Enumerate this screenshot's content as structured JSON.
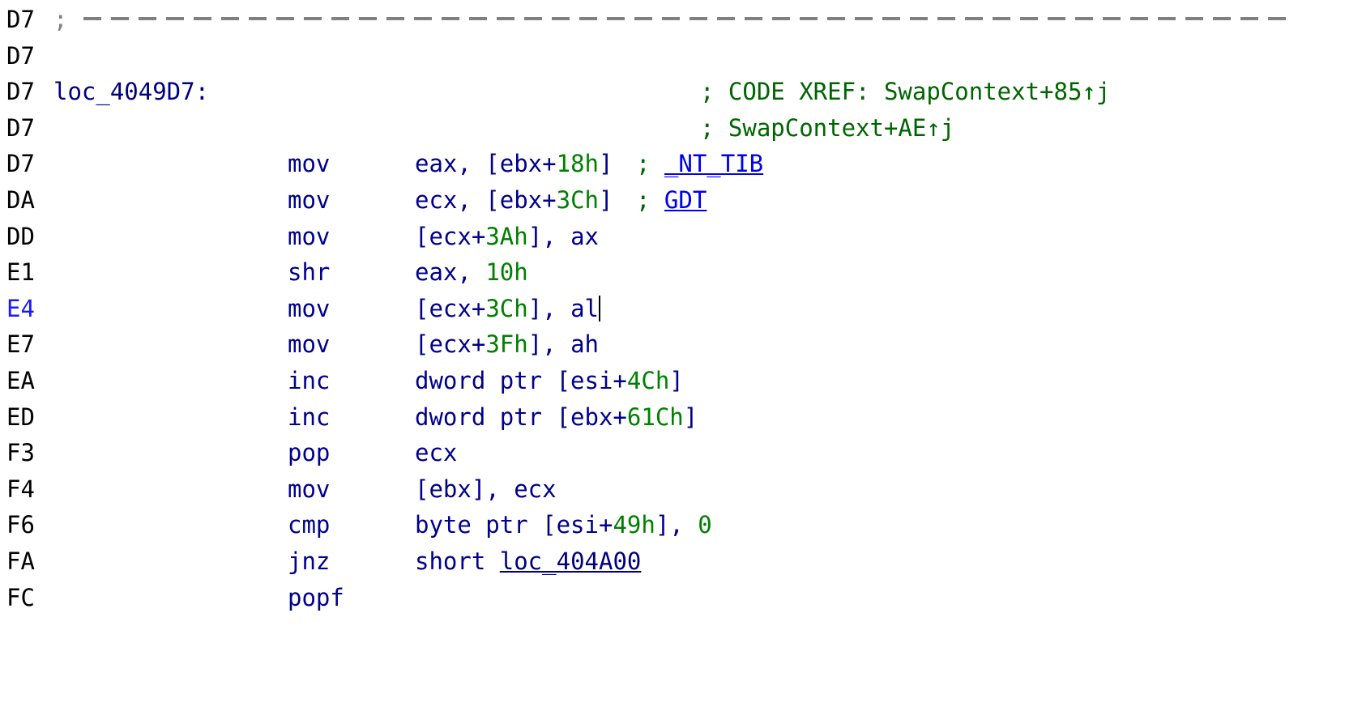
{
  "view": {
    "type": "disassembly-listing",
    "app": "IDA Pro",
    "colors": {
      "background": "#ffffff",
      "address": "#000000",
      "address_current": "#1a1aff",
      "mnemonic": "#00008b",
      "register": "#00008b",
      "number": "#008000",
      "comment": "#006400",
      "symbol": "#0000ee",
      "label": "#00007f",
      "separator": "#808080"
    }
  },
  "lines": [
    {
      "address": "D7",
      "kind": "separator",
      "text": ";  ------------------------------------------------------------"
    },
    {
      "address": "D7",
      "kind": "blank",
      "text": ""
    },
    {
      "address": "D7",
      "kind": "label",
      "label": "loc_4049D7:",
      "comment": "; CODE XREF: SwapContext+85↑j"
    },
    {
      "address": "D7",
      "kind": "comment-only",
      "comment": "; SwapContext+AE↑j"
    },
    {
      "address": "D7",
      "kind": "instruction",
      "mnemonic": "mov",
      "op_reg": "eax, [ebx+",
      "op_num": "18h",
      "op_tail": "]",
      "comment_semi": "; ",
      "comment_sym": "_NT_TIB"
    },
    {
      "address": "DA",
      "kind": "instruction",
      "mnemonic": "mov",
      "op_reg": "ecx, [ebx+",
      "op_num": "3Ch",
      "op_tail": "]",
      "comment_semi": "; ",
      "comment_sym": "GDT"
    },
    {
      "address": "DD",
      "kind": "instruction",
      "mnemonic": "mov",
      "op_reg": "[ecx+",
      "op_num": "3Ah",
      "op_tail": "], ax"
    },
    {
      "address": "E1",
      "kind": "instruction",
      "mnemonic": "shr",
      "op_reg": "eax, ",
      "op_num": "10h",
      "op_tail": ""
    },
    {
      "address": "E4",
      "current": true,
      "kind": "instruction",
      "mnemonic": "mov",
      "op_reg": "[ecx+",
      "op_num": "3Ch",
      "op_tail": "], al",
      "caret": true
    },
    {
      "address": "E7",
      "kind": "instruction",
      "mnemonic": "mov",
      "op_reg": "[ecx+",
      "op_num": "3Fh",
      "op_tail": "], ah"
    },
    {
      "address": "EA",
      "kind": "instruction",
      "mnemonic": "inc",
      "op_reg": "dword ptr [esi+",
      "op_num": "4Ch",
      "op_tail": "]"
    },
    {
      "address": "ED",
      "kind": "instruction",
      "mnemonic": "inc",
      "op_reg": "dword ptr [ebx+",
      "op_num": "61Ch",
      "op_tail": "]"
    },
    {
      "address": "F3",
      "kind": "instruction",
      "mnemonic": "pop",
      "op_reg": "ecx",
      "op_num": "",
      "op_tail": ""
    },
    {
      "address": "F4",
      "kind": "instruction",
      "mnemonic": "mov",
      "op_reg": "[ebx], ecx",
      "op_num": "",
      "op_tail": ""
    },
    {
      "address": "F6",
      "kind": "instruction",
      "mnemonic": "cmp",
      "op_reg": "byte ptr [esi+",
      "op_num": "49h",
      "op_tail": "], ",
      "op_num2": "0"
    },
    {
      "address": "FA",
      "kind": "instruction-jump",
      "mnemonic": "jnz",
      "op_pre": "short ",
      "op_link": "loc_404A00"
    },
    {
      "address": "FC",
      "kind": "instruction",
      "mnemonic": "popf",
      "op_reg": "",
      "op_num": "",
      "op_tail": ""
    }
  ]
}
